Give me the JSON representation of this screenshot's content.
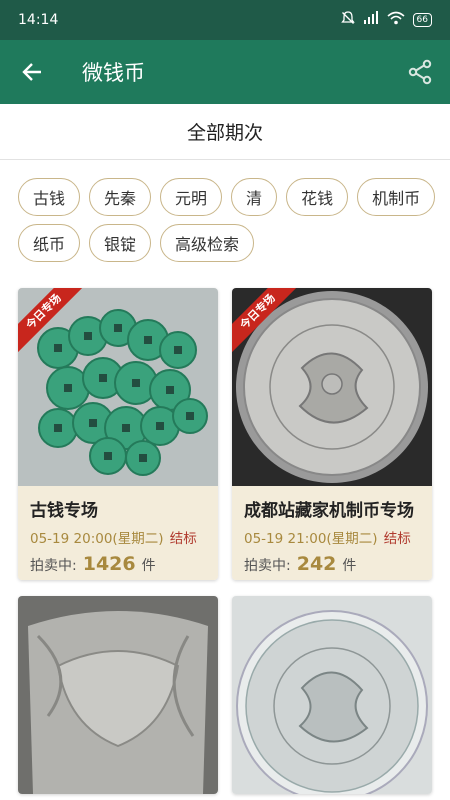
{
  "statusbar": {
    "time": "14:14",
    "battery": "66"
  },
  "appbar": {
    "title": "微钱币",
    "back_icon": "arrow-left-icon",
    "share_icon": "share-icon"
  },
  "section": {
    "title": "全部期次"
  },
  "filters": [
    "古钱",
    "先秦",
    "元明",
    "清",
    "花钱",
    "机制币",
    "纸币",
    "银锭",
    "高级检索"
  ],
  "cards": [
    {
      "badge": "今日专场",
      "name": "古钱专场",
      "time": "05-19 20:00(星期二)",
      "status": "结标",
      "count_label": "拍卖中:",
      "count": "1426",
      "unit": "件"
    },
    {
      "badge": "今日专场",
      "name": "成都站藏家机制币专场",
      "time": "05-19 21:00(星期二)",
      "status": "结标",
      "count_label": "拍卖中:",
      "count": "242",
      "unit": "件"
    }
  ],
  "colors": {
    "appbar": "#1f7a5c",
    "statusbar": "#1f5a48",
    "chip_border": "#c9b68a",
    "accent_gold": "#a8893e",
    "status_red": "#b03a2e",
    "ribbon_red": "#c8261d"
  }
}
